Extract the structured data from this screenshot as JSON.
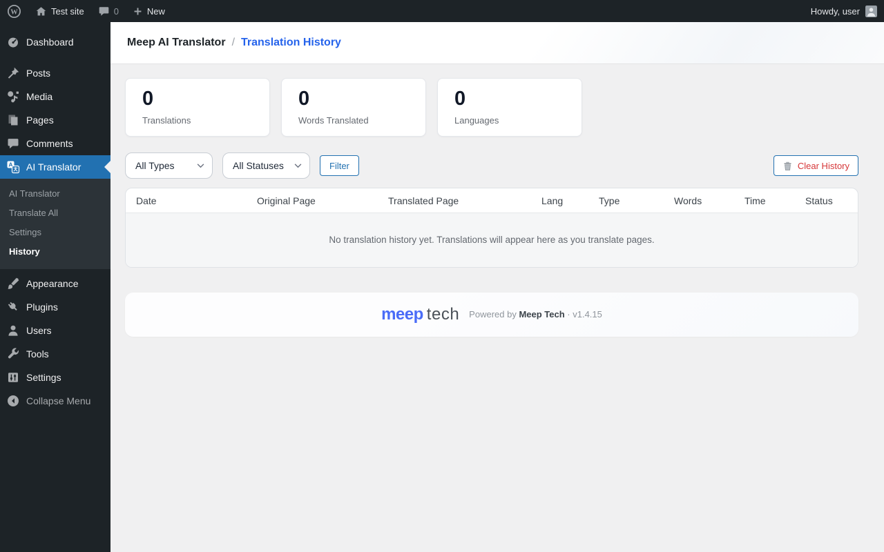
{
  "admin_bar": {
    "site_name": "Test site",
    "comment_count": "0",
    "new_label": "New",
    "howdy": "Howdy, user"
  },
  "sidebar": {
    "items": [
      {
        "label": "Dashboard",
        "icon": "dashboard-icon"
      },
      {
        "label": "Posts",
        "icon": "pushpin-icon"
      },
      {
        "label": "Media",
        "icon": "media-icon"
      },
      {
        "label": "Pages",
        "icon": "pages-icon"
      },
      {
        "label": "Comments",
        "icon": "comments-icon"
      },
      {
        "label": "AI Translator",
        "icon": "translator-icon",
        "active": true
      },
      {
        "label": "Appearance",
        "icon": "appearance-icon"
      },
      {
        "label": "Plugins",
        "icon": "plugin-icon"
      },
      {
        "label": "Users",
        "icon": "users-icon"
      },
      {
        "label": "Tools",
        "icon": "tools-icon"
      },
      {
        "label": "Settings",
        "icon": "settings-icon"
      }
    ],
    "submenu": {
      "items": [
        {
          "label": "AI Translator"
        },
        {
          "label": "Translate All"
        },
        {
          "label": "Settings"
        },
        {
          "label": "History",
          "active": true
        }
      ]
    },
    "collapse_label": "Collapse Menu"
  },
  "breadcrumb": {
    "parent": "Meep AI Translator",
    "separator": "/",
    "current": "Translation History"
  },
  "stats": [
    {
      "value": "0",
      "label": "Translations"
    },
    {
      "value": "0",
      "label": "Words Translated"
    },
    {
      "value": "0",
      "label": "Languages"
    }
  ],
  "filters": {
    "type_value": "All Types",
    "status_value": "All Statuses",
    "filter_label": "Filter",
    "clear_label": "Clear History"
  },
  "table": {
    "columns": [
      "Date",
      "Original Page",
      "Translated Page",
      "Lang",
      "Type",
      "Words",
      "Time",
      "Status"
    ],
    "empty_message": "No translation history yet. Translations will appear here as you translate pages."
  },
  "footer": {
    "logo_primary": "meep",
    "logo_secondary": "tech",
    "powered_prefix": "Powered by",
    "brand": "Meep Tech",
    "version_suffix": "· v1.4.15"
  },
  "colors": {
    "accent_blue": "#2271b1",
    "link_blue": "#2563eb",
    "brand_blue": "#4a6cf7",
    "danger_red": "#d63638",
    "sidebar_dark": "#1d2327",
    "submenu_dark": "#2c3338",
    "content_bg": "#f0f0f1"
  }
}
